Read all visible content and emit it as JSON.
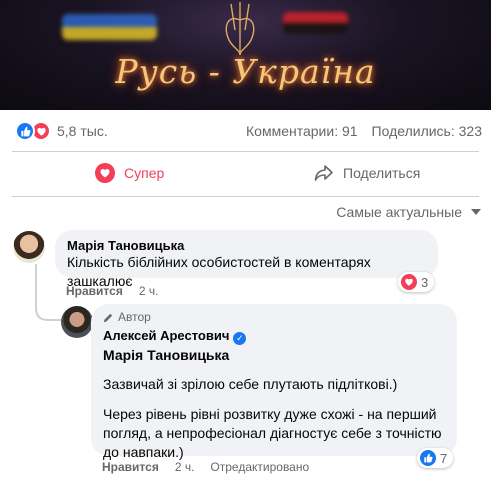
{
  "banner": {
    "title": "Русь - Україна"
  },
  "post_stats": {
    "reaction_icons": [
      "like-icon",
      "love-icon"
    ],
    "reaction_count": "5,8 тыс.",
    "comments": "Комментарии: 91",
    "shares": "Поделились: 323"
  },
  "actions": {
    "super_label": "Супер",
    "share_label": "Поделиться"
  },
  "sort": {
    "label": "Самые актуальные"
  },
  "comments": [
    {
      "author": "Марія Тановицька",
      "text": "Кількість біблійних особистостей в коментарях зашкалює",
      "like_label": "Нравится",
      "time": "2 ч.",
      "reaction_count": "3",
      "reaction_icon": "love-icon"
    },
    {
      "badge": "Автор",
      "author": "Алексей Арестович",
      "mention": "Марія Тановицька",
      "paragraph1": "Зазвичай зі зрілою себе плутають підліткові.)",
      "paragraph2": "Через рівень рівні розвитку дуже схожі - на перший погляд, а непрофесіонал діагностує себе з точністю до навпаки.)",
      "like_label": "Нравится",
      "time": "2 ч.",
      "edited": "Отредактировано",
      "reaction_count": "7",
      "reaction_icon": "like-icon"
    }
  ],
  "colors": {
    "accent_blue": "#1877f2",
    "love_red": "#f33e58",
    "secondary_text": "#65676b",
    "bubble_bg": "#f0f2f5"
  }
}
